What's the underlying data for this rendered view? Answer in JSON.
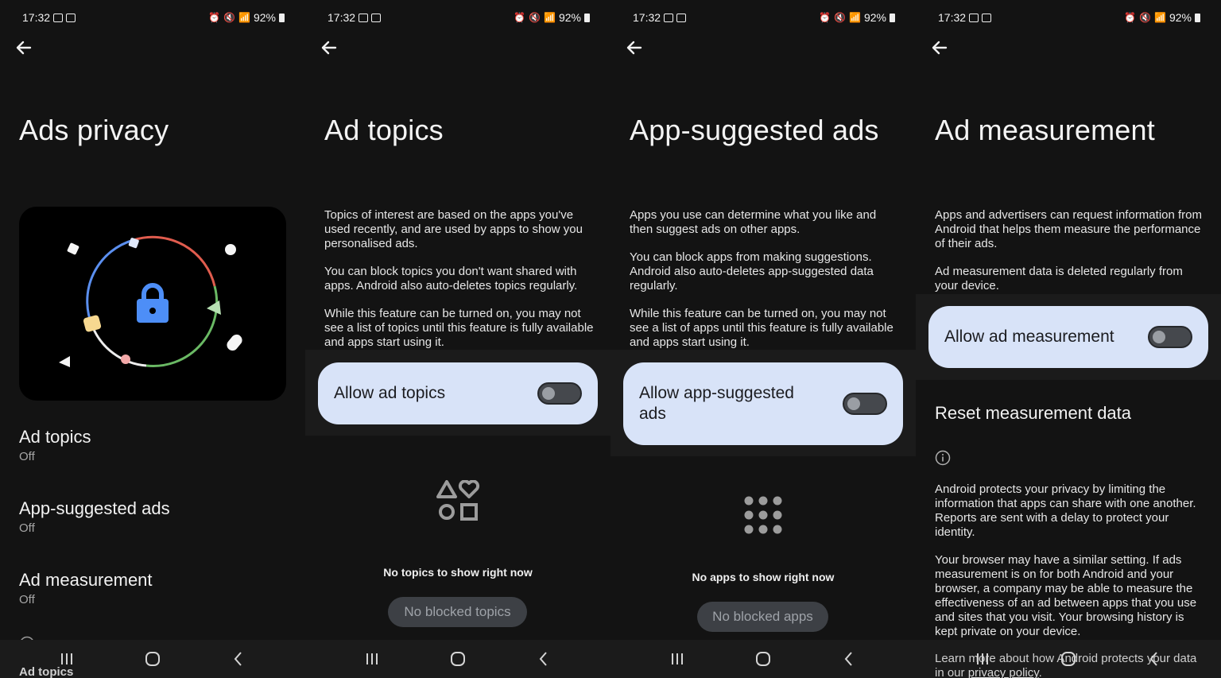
{
  "status": {
    "time": "17:32",
    "battery": "92%"
  },
  "colors": {
    "card_bg": "#d8e3f8",
    "screen_bg": "#131313",
    "lock_blue": "#4d8ef7"
  },
  "screens": {
    "privacy": {
      "title": "Ads privacy",
      "items": [
        {
          "title": "Ad topics",
          "status": "Off"
        },
        {
          "title": "App-suggested ads",
          "status": "Off"
        },
        {
          "title": "Ad measurement",
          "status": "Off"
        }
      ],
      "footer_label": "Ad topics"
    },
    "topics": {
      "title": "Ad topics",
      "paragraphs": [
        "Topics of interest are based on the apps you've used recently, and are used by apps to show you personalised ads.",
        "You can block topics you don't want shared with apps. Android also auto-deletes topics regularly.",
        "While this feature can be turned on, you may not see a list of topics until this feature is fully available and apps start using it."
      ],
      "toggle_label": "Allow ad topics",
      "toggle_on": false,
      "empty_message": "No topics to show right now",
      "blocked_button": "No blocked topics"
    },
    "suggested": {
      "title": "App-suggested ads",
      "paragraphs": [
        "Apps you use can determine what you like and then suggest ads on other apps.",
        "You can block apps from making suggestions. Android also auto-deletes app-suggested data regularly.",
        "While this feature can be turned on, you may not see a list of apps until this feature is fully available and apps start using it."
      ],
      "toggle_label": "Allow app-suggested ads",
      "toggle_on": false,
      "empty_message": "No apps to show right now",
      "blocked_button": "No blocked apps"
    },
    "measurement": {
      "title": "Ad measurement",
      "paragraphs": [
        "Apps and advertisers can request information from Android that helps them measure the performance of their ads.",
        "Ad measurement data is deleted regularly from your device."
      ],
      "toggle_label": "Allow ad measurement",
      "toggle_on": false,
      "reset_label": "Reset measurement data",
      "info_paragraphs": [
        "Android protects your privacy by limiting the information that apps can share with one another. Reports are sent with a delay to protect your identity.",
        "Your browser may have a similar setting. If ads measurement is on for both Android and your browser, a company may be able to measure the effectiveness of an ad between apps that you use and sites that you visit. Your browsing history is kept private on your device."
      ],
      "learn_more_prefix": "Learn more about how Android protects your data in our ",
      "learn_more_link": "privacy policy",
      "learn_more_suffix": "."
    }
  }
}
